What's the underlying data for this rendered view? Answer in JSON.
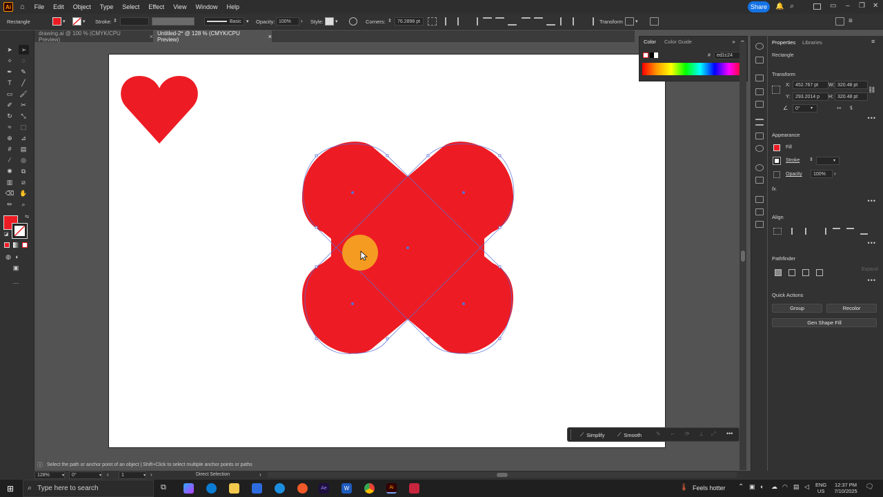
{
  "menubar": {
    "logo": "Ai",
    "menus": [
      "File",
      "Edit",
      "Object",
      "Type",
      "Select",
      "Effect",
      "View",
      "Window",
      "Help"
    ],
    "share_label": "Share"
  },
  "control": {
    "object_type": "Rectangle",
    "stroke_label": "Stroke:",
    "brush_label": "Basic",
    "opacity_label": "Opacity:",
    "opacity_value": "100%",
    "style_label": "Style:",
    "corners_label": "Corners:",
    "corners_value": "76.2898 pt",
    "transform_label": "Transform"
  },
  "tabs": [
    {
      "label": "drawing.ai @ 100 % (CMYK/CPU Preview)",
      "close": "×"
    },
    {
      "label": "Untitled-2* @ 128 % (CMYK/CPU Preview)",
      "close": "×"
    }
  ],
  "color_panel": {
    "tab_color": "Color",
    "tab_guide": "Color Guide",
    "hash": "#",
    "hex": "ed1c24"
  },
  "properties": {
    "tab_properties": "Properties",
    "tab_libraries": "Libraries",
    "object_type": "Rectangle",
    "transform_title": "Transform",
    "x_label": "X:",
    "x_value": "452.767 pt",
    "y_label": "Y:",
    "y_value": "293.2014 p",
    "w_label": "W:",
    "w_value": "320.48 pt",
    "h_label": "H:",
    "h_value": "320.48 pt",
    "angle_value": "0°",
    "appearance_title": "Appearance",
    "fill_label": "Fill",
    "stroke_label": "Stroke",
    "opacity_label": "Opacity",
    "opacity_value": "100%",
    "fx_label": "fx.",
    "align_title": "Align",
    "pathfinder_title": "Pathfinder",
    "expand_label": "Expand",
    "quick_actions_title": "Quick Actions",
    "group_label": "Group",
    "recolor_label": "Recolor",
    "gen_shape_fill_label": "Gen Shape Fill"
  },
  "simplify_bar": {
    "simplify_label": "Simplify",
    "smooth_label": "Smooth"
  },
  "hint": "Select the path or anchor point of an object  |  Shift+Click to select multiple anchor points or paths",
  "status": {
    "zoom": "128%",
    "rotation": "0°",
    "artboard_num": "1",
    "tool": "Direct Selection"
  },
  "taskbar": {
    "search_placeholder": "Type here to search",
    "weather": "Feels hotter",
    "lang": "ENG",
    "region": "US",
    "time": "12:37 PM",
    "date": "7/10/2025"
  },
  "colors": {
    "fill_red": "#ed1c24",
    "cursor_highlight": "#f5a623",
    "share_blue": "#1473e6"
  }
}
